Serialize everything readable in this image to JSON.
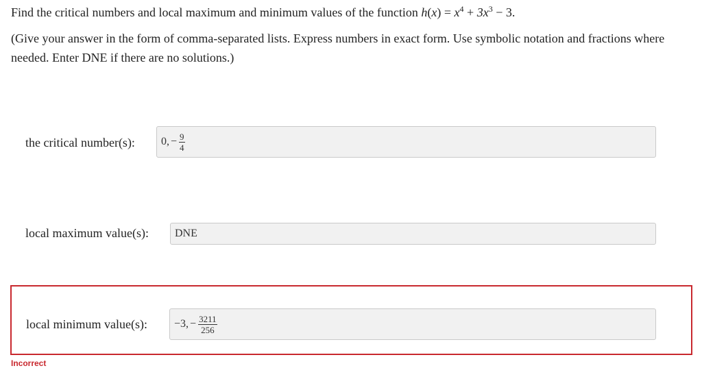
{
  "question": {
    "prefix": "Find the critical numbers and local maximum and minimum values of the function",
    "fn_name": "h",
    "fn_var": "x",
    "equals": "=",
    "term1_base": "x",
    "term1_exp": "4",
    "plus": "+",
    "term2_base": "3x",
    "term2_exp": "3",
    "minus": "−",
    "constant": "3."
  },
  "instructions": "(Give your answer in the form of comma-separated lists. Express numbers in exact form. Use symbolic notation and fractions where needed. Enter DNE if there are no solutions.)",
  "fields": {
    "critical": {
      "label": "the critical number(s):",
      "value_lead": "0,",
      "value_sign": "−",
      "frac_num": "9",
      "frac_den": "4"
    },
    "local_max": {
      "label": "local maximum value(s):",
      "value": "DNE"
    },
    "local_min": {
      "label": "local minimum value(s):",
      "value_lead": "−3,",
      "value_sign": "−",
      "frac_num": "3211",
      "frac_den": "256"
    }
  },
  "status": {
    "text": "Incorrect",
    "color": "#c8282e"
  },
  "colors": {
    "error_border": "#c8282e",
    "input_bg": "#f1f1f1",
    "input_border": "#c9c9c9"
  }
}
